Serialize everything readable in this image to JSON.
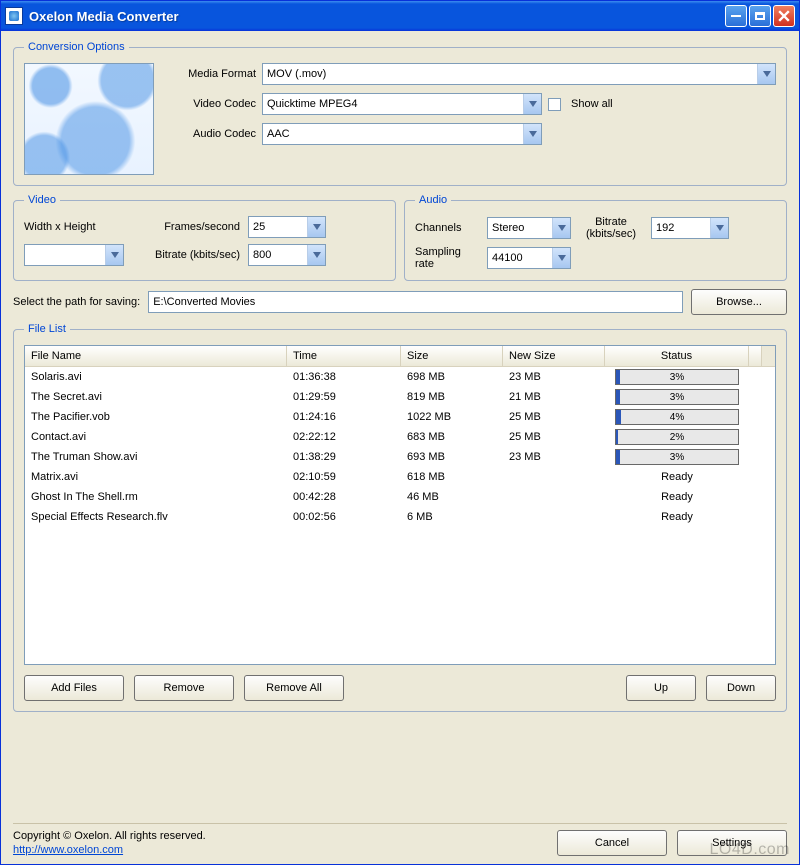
{
  "window": {
    "title": "Oxelon Media Converter"
  },
  "conversion": {
    "legend": "Conversion Options",
    "media_format_label": "Media Format",
    "media_format_value": "MOV (.mov)",
    "video_codec_label": "Video Codec",
    "video_codec_value": "Quicktime MPEG4",
    "audio_codec_label": "Audio Codec",
    "audio_codec_value": "AAC",
    "show_all_label": "Show all",
    "show_all_checked": false
  },
  "video": {
    "legend": "Video",
    "width_height_label": "Width x Height",
    "width_height_value": "",
    "fps_label": "Frames/second",
    "fps_value": "25",
    "bitrate_label": "Bitrate (kbits/sec)",
    "bitrate_value": "800"
  },
  "audio": {
    "legend": "Audio",
    "channels_label": "Channels",
    "channels_value": "Stereo",
    "sampling_label": "Sampling rate",
    "sampling_value": "44100",
    "bitrate_label": "Bitrate (kbits/sec)",
    "bitrate_value": "192"
  },
  "path": {
    "label": "Select the path for saving:",
    "value": "E:\\Converted Movies",
    "browse_label": "Browse..."
  },
  "filelist": {
    "legend": "File List",
    "headers": {
      "filename": "File Name",
      "time": "Time",
      "size": "Size",
      "newsize": "New Size",
      "status": "Status"
    },
    "rows": [
      {
        "name": "Solaris.avi",
        "time": "01:36:38",
        "size": "698 MB",
        "newsize": "23 MB",
        "progress": 3
      },
      {
        "name": "The Secret.avi",
        "time": "01:29:59",
        "size": "819 MB",
        "newsize": "21 MB",
        "progress": 3
      },
      {
        "name": "The Pacifier.vob",
        "time": "01:24:16",
        "size": "1022 MB",
        "newsize": "25 MB",
        "progress": 4
      },
      {
        "name": "Contact.avi",
        "time": "02:22:12",
        "size": "683 MB",
        "newsize": "25 MB",
        "progress": 2
      },
      {
        "name": "The Truman Show.avi",
        "time": "01:38:29",
        "size": "693 MB",
        "newsize": "23 MB",
        "progress": 3
      },
      {
        "name": "Matrix.avi",
        "time": "02:10:59",
        "size": "618 MB",
        "newsize": "",
        "status": "Ready"
      },
      {
        "name": "Ghost In The Shell.rm",
        "time": "00:42:28",
        "size": "46 MB",
        "newsize": "",
        "status": "Ready"
      },
      {
        "name": "Special Effects Research.flv",
        "time": "00:02:56",
        "size": "6 MB",
        "newsize": "",
        "status": "Ready"
      }
    ],
    "buttons": {
      "add": "Add Files",
      "remove": "Remove",
      "remove_all": "Remove All",
      "up": "Up",
      "down": "Down"
    }
  },
  "footer": {
    "copyright": "Copyright © Oxelon. All rights reserved.",
    "url": "http://www.oxelon.com",
    "cancel": "Cancel",
    "settings": "Settings"
  },
  "watermark": "LO4D.com"
}
